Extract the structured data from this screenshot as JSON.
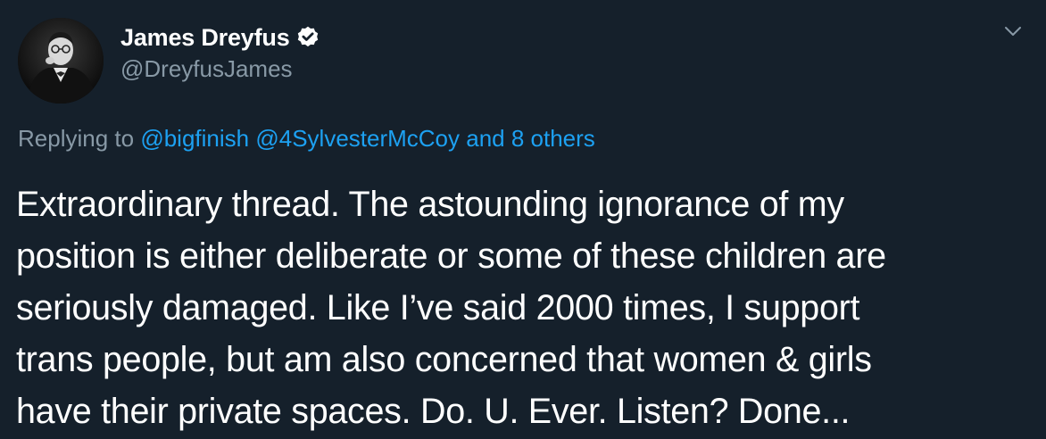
{
  "author": {
    "display_name": "James Dreyfus",
    "handle": "@DreyfusJames",
    "verified": true
  },
  "reply": {
    "prefix": "Replying to",
    "mentions": [
      "@bigfinish",
      "@4SylvesterMcCoy"
    ],
    "others": "and 8 others"
  },
  "tweet": {
    "lines": [
      "Extraordinary thread. The astounding ignorance of my",
      "position is either deliberate or some of these children are",
      "seriously damaged. Like I’ve said 2000 times, I support",
      "trans people, but am also concerned that women & girls",
      "have their private spaces. Do. U. Ever. Listen? Done..."
    ]
  },
  "icons": {
    "verified": "verified-badge-icon",
    "menu": "chevron-down-icon"
  },
  "colors": {
    "background": "#15202b",
    "primary_text": "#ffffff",
    "secondary_text": "#8899a6",
    "link": "#1da1f2"
  }
}
